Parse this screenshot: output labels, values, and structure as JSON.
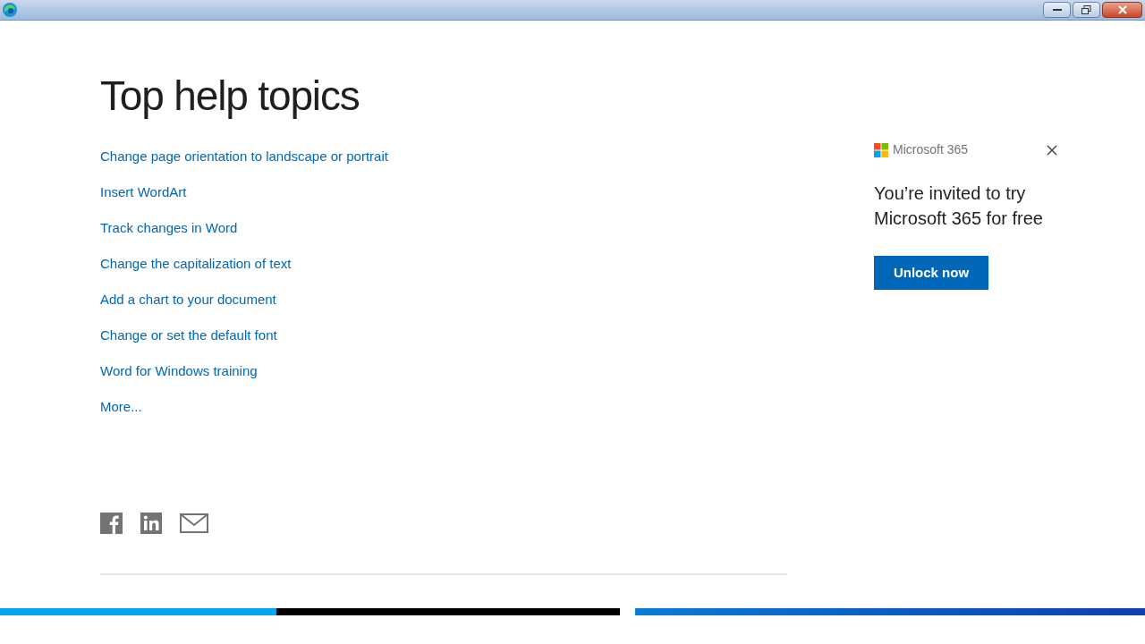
{
  "heading": "Top help topics",
  "topics": [
    "Change page orientation to landscape or portrait",
    "Insert WordArt",
    "Track changes in Word",
    "Change the capitalization of text",
    "Add a chart to your document",
    "Change or set the default font",
    "Word for Windows training",
    "More..."
  ],
  "promo": {
    "brand": "Microsoft 365",
    "message": "You’re invited to try Microsoft 365 for free",
    "button": "Unlock now"
  }
}
